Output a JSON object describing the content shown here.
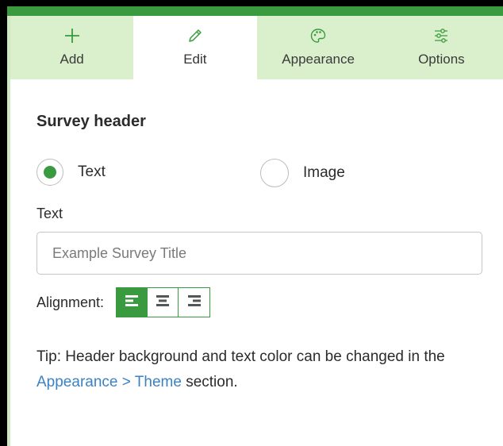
{
  "tabs": [
    {
      "label": "Add",
      "icon": "plus-icon",
      "active": false
    },
    {
      "label": "Edit",
      "icon": "pencil-icon",
      "active": true
    },
    {
      "label": "Appearance",
      "icon": "palette-icon",
      "active": false
    },
    {
      "label": "Options",
      "icon": "sliders-icon",
      "active": false
    }
  ],
  "section": {
    "title": "Survey header"
  },
  "header_type": {
    "options": [
      {
        "label": "Text",
        "selected": true
      },
      {
        "label": "Image",
        "selected": false
      }
    ]
  },
  "text_field": {
    "label": "Text",
    "value": "",
    "placeholder": "Example Survey Title"
  },
  "alignment": {
    "label": "Alignment:",
    "selected": "left",
    "options": [
      "left",
      "center",
      "right"
    ]
  },
  "tip": {
    "prefix": "Tip: Header background and text color can be changed in the ",
    "link": "Appearance > Theme",
    "suffix": " section."
  },
  "colors": {
    "accent": "#3a9a3f",
    "tab_bg": "#daf0cc",
    "link": "#3b82c4"
  }
}
